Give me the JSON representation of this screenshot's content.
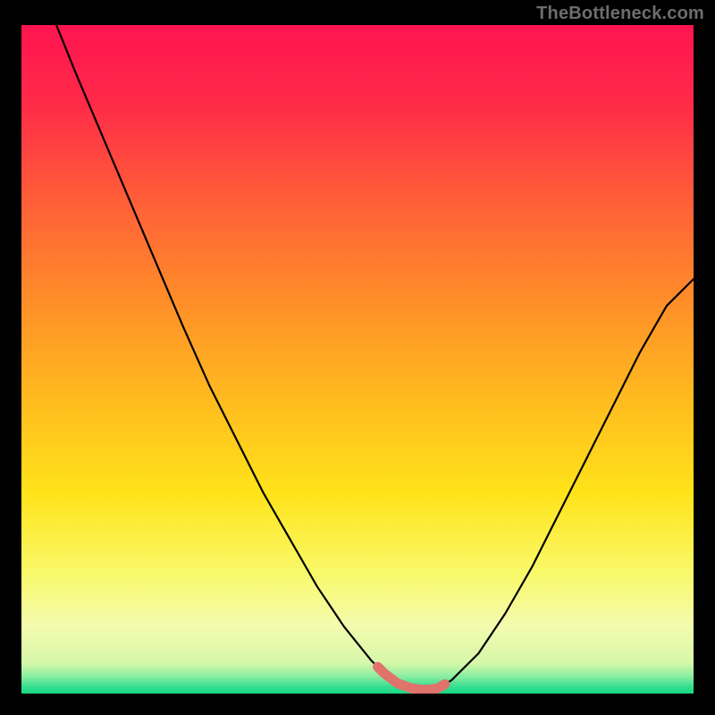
{
  "watermark": "TheBottleneck.com",
  "colors": {
    "background": "#000000",
    "watermark": "#6d6d6d",
    "curve_stroke": "#000000",
    "highlight_stroke": "#e0736c",
    "gradient_stops": [
      {
        "offset": 0.0,
        "color": "#ff1450"
      },
      {
        "offset": 0.12,
        "color": "#ff2b48"
      },
      {
        "offset": 0.25,
        "color": "#ff5a39"
      },
      {
        "offset": 0.4,
        "color": "#ff8a2a"
      },
      {
        "offset": 0.55,
        "color": "#ffb81f"
      },
      {
        "offset": 0.7,
        "color": "#ffe31a"
      },
      {
        "offset": 0.82,
        "color": "#f9f96a"
      },
      {
        "offset": 0.9,
        "color": "#f3fbaf"
      },
      {
        "offset": 0.955,
        "color": "#d6f7a9"
      },
      {
        "offset": 0.975,
        "color": "#87eda0"
      },
      {
        "offset": 0.99,
        "color": "#34de8f"
      },
      {
        "offset": 1.0,
        "color": "#18d884"
      }
    ]
  },
  "chart_data": {
    "type": "line",
    "title": "",
    "xlabel": "",
    "ylabel": "",
    "xlim": [
      0,
      100
    ],
    "ylim": [
      0,
      100
    ],
    "notes": "V-shaped bottleneck curve. High value = more bottleneck (red top), 0 = ideal (green bottom). Flat trough with pink highlight is the optimal zone.",
    "x": [
      0,
      4,
      8,
      12,
      16,
      20,
      24,
      28,
      32,
      36,
      40,
      44,
      48,
      52,
      54,
      56,
      58,
      60,
      62,
      64,
      68,
      72,
      76,
      80,
      84,
      88,
      92,
      96,
      100
    ],
    "values": [
      110,
      103,
      93,
      83.5,
      74,
      64.5,
      55,
      46,
      38,
      30,
      23,
      16,
      10,
      5,
      3,
      1.5,
      0.8,
      0.5,
      0.8,
      2,
      6,
      12,
      19,
      27,
      35,
      43,
      51,
      58,
      62
    ],
    "trough_highlight": {
      "x_start": 53,
      "x_end": 63,
      "y": 0.6
    }
  }
}
